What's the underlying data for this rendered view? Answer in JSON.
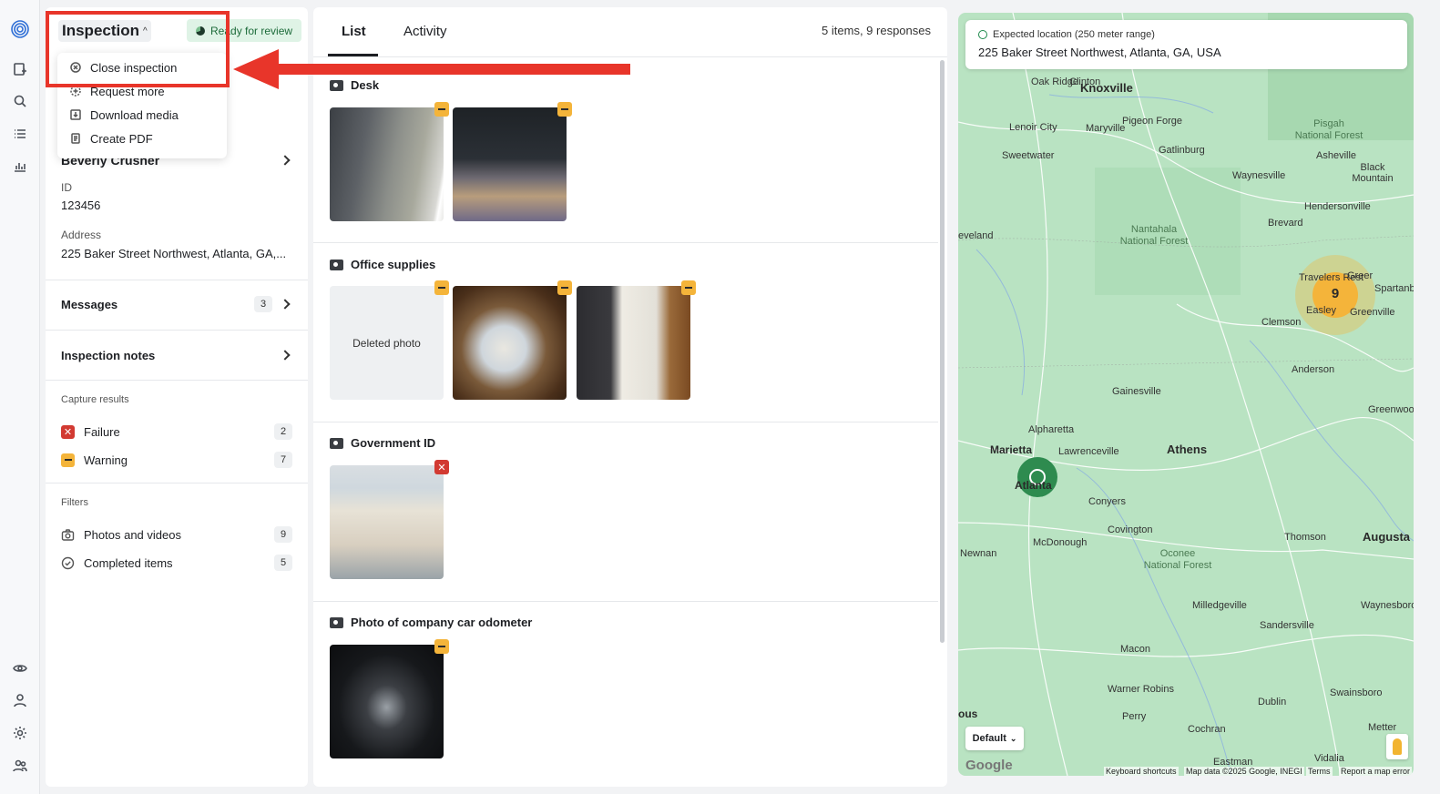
{
  "rail": {
    "icons": [
      "logo-icon",
      "add-inspection-icon",
      "search-icon",
      "list-icon",
      "chart-icon",
      "eye-icon",
      "user-icon",
      "gear-icon",
      "team-icon"
    ]
  },
  "header": {
    "title": "Inspection",
    "status": "Ready for review"
  },
  "menu": {
    "items": [
      "Close inspection",
      "Request more",
      "Download media",
      "Create PDF"
    ]
  },
  "details": {
    "person": "Beverly Crusher",
    "id_label": "ID",
    "id_value": "123456",
    "address_label": "Address",
    "address_value": "225 Baker Street Northwest, Atlanta, GA,..."
  },
  "links": {
    "messages": "Messages",
    "messages_count": "3",
    "notes": "Inspection notes"
  },
  "capture": {
    "title": "Capture results",
    "failure": "Failure",
    "failure_count": "2",
    "warning": "Warning",
    "warning_count": "7"
  },
  "filters": {
    "title": "Filters",
    "photos": "Photos and videos",
    "photos_count": "9",
    "completed": "Completed items",
    "completed_count": "5"
  },
  "tabs": {
    "list": "List",
    "activity": "Activity",
    "summary": "5 items, 9 responses"
  },
  "sections": {
    "desk": "Desk",
    "office": "Office supplies",
    "deleted": "Deleted photo",
    "gov": "Government ID",
    "odometer": "Photo of company car odometer"
  },
  "map": {
    "expected_label": "Expected location (250 meter range)",
    "address": "225 Baker Street Northwest, Atlanta, GA, USA",
    "cluster_count": "9",
    "layer": "Default",
    "google": "Google",
    "shortcuts": "Keyboard shortcuts",
    "mapdata": "Map data ©2025 Google, INEGI",
    "terms": "Terms",
    "report": "Report a map error",
    "places": {
      "knoxville": "Knoxville",
      "oakridge": "Oak Ridge",
      "clinton": "Clinton",
      "maryville": "Maryville",
      "lenoir": "Lenoir City",
      "pigeon": "Pigeon Forge",
      "gatlinburg": "Gatlinburg",
      "sweetwater": "Sweetwater",
      "waynesville": "Waynesville",
      "asheville": "Asheville",
      "blackmtn": "Black Mountain",
      "hendersonville": "Hendersonville",
      "brevard": "Brevard",
      "travelers": "Travelers Rest",
      "greer": "Greer",
      "spartanburg": "Spartanbu",
      "easley": "Easley",
      "greenville": "Greenville",
      "clemson": "Clemson",
      "anderson": "Anderson",
      "greenwood": "Greenwood",
      "gainesville": "Gainesville",
      "alpharetta": "Alpharetta",
      "marietta": "Marietta",
      "lawrenceville": "Lawrenceville",
      "athens": "Athens",
      "atlanta": "Atlanta",
      "conyers": "Conyers",
      "covington": "Covington",
      "mcdonough": "McDonough",
      "newnan": "Newnan",
      "thomson": "Thomson",
      "augusta": "Augusta",
      "milledgeville": "Milledgeville",
      "sandersville": "Sandersville",
      "waynesboro": "Waynesboro",
      "macon": "Macon",
      "warnerrobins": "Warner Robins",
      "perry": "Perry",
      "dublin": "Dublin",
      "swainsboro": "Swainsboro",
      "cochran": "Cochran",
      "eastman": "Eastman",
      "vidalia": "Vidalia",
      "metter": "Metter",
      "cleveland": "eveland",
      "columbus": "ous",
      "pisgah": "Pisgah\nNational Forest",
      "nantahala": "Nantahala\nNational Forest",
      "oconee": "Oconee\nNational Forest"
    }
  },
  "colors": {
    "annotation": "#e8352a",
    "failure": "#d23a32",
    "warning": "#f4b43a",
    "map_land": "#b9e3c2",
    "location_marker": "#2e8b4f",
    "cluster": "#f4b43a"
  }
}
